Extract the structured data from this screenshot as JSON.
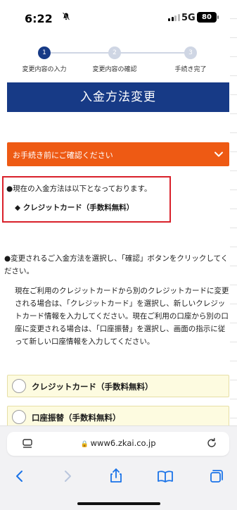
{
  "status_bar": {
    "time": "6:22",
    "network": "5G",
    "battery": "80"
  },
  "stepper": {
    "steps": [
      {
        "number": "1",
        "label": "変更内容の入力"
      },
      {
        "number": "2",
        "label": "変更内容の確認"
      },
      {
        "number": "3",
        "label": "手続き完了"
      }
    ],
    "current_step": 1
  },
  "page": {
    "title": "入金方法変更"
  },
  "accordion": {
    "label": "お手続き前にご確認ください"
  },
  "current": {
    "intro": "●現在の入金方法は以下となっております。",
    "method": "◆ クレジットカード（手数料無料）"
  },
  "instructions": {
    "text": "●変更されるご入金方法を選択し、「確認」ボタンをクリックしてください。",
    "note": "現在ご利用のクレジットカードから別のクレジットカードに変更される場合は、「クレジットカード」を選択し、新しいクレジットカード情報を入力してください。現在ご利用の口座から別の口座に変更される場合は、「口座振替」を選択し、画面の指示に従って新しい口座情報を入力してください。"
  },
  "options": [
    {
      "label": "クレジットカード（手数料無料）"
    },
    {
      "label": "口座振替（手数料無料）"
    }
  ],
  "browser": {
    "url": "www6.zkai.co.jp"
  },
  "colors": {
    "navy": "#173a86",
    "orange": "#ee5a14",
    "red_border": "#d9202a",
    "option_bg": "#fdfbe0",
    "ios_blue": "#1a73e8"
  }
}
